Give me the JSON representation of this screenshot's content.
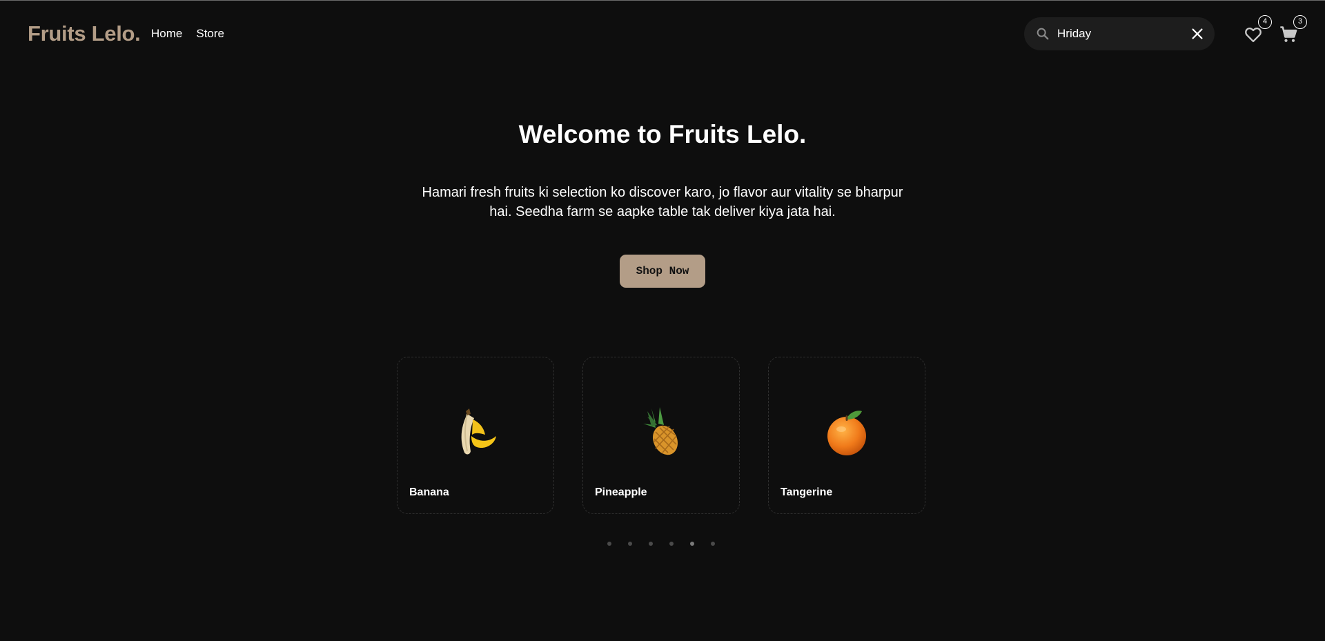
{
  "header": {
    "logo": "Fruits Lelo.",
    "nav": [
      {
        "label": "Home"
      },
      {
        "label": "Store"
      }
    ],
    "search": {
      "value": "Hriday",
      "placeholder": "Search"
    },
    "wishlist_count": "4",
    "cart_count": "3"
  },
  "hero": {
    "title": "Welcome to Fruits Lelo.",
    "text": "Hamari fresh fruits ki selection ko discover karo, jo flavor aur vitality se bharpur hai. Seedha farm se aapke table tak deliver kiya jata hai.",
    "cta": "Shop Now"
  },
  "carousel": {
    "items": [
      {
        "name": "Banana",
        "icon": "banana-icon"
      },
      {
        "name": "Pineapple",
        "icon": "pineapple-icon"
      },
      {
        "name": "Tangerine",
        "icon": "tangerine-icon"
      }
    ],
    "dot_count": 6,
    "active_dot": 4
  },
  "colors": {
    "background": "#0e0e0e",
    "accent": "#b39d87",
    "card_border": "#303030"
  }
}
